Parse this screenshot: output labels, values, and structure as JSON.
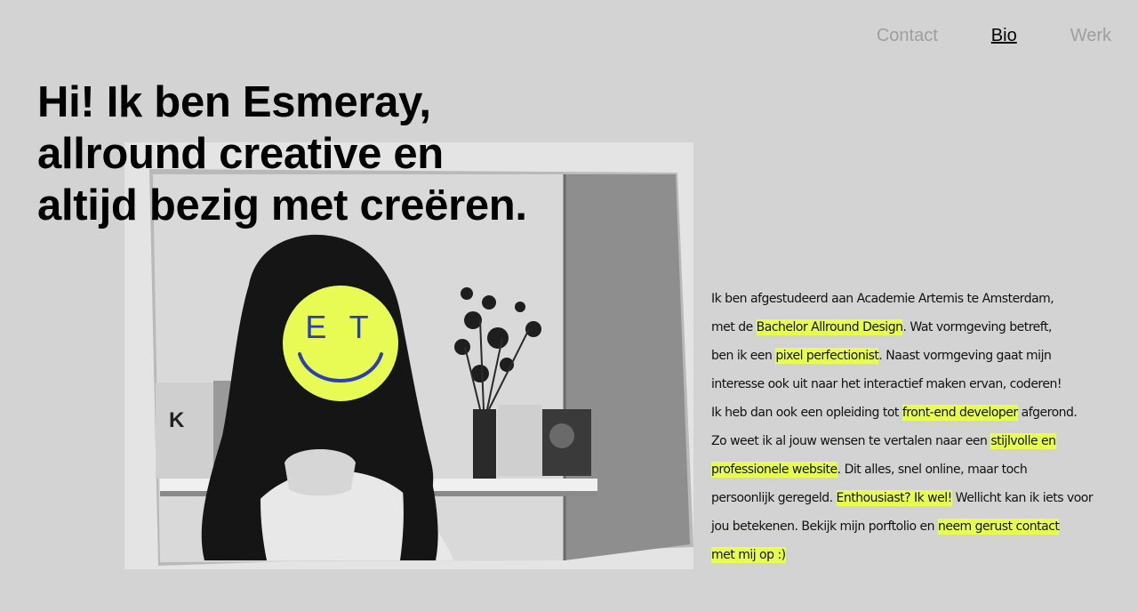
{
  "nav": {
    "items": [
      {
        "label": "Contact",
        "active": false
      },
      {
        "label": "Bio",
        "active": true
      },
      {
        "label": "Werk",
        "active": false
      }
    ]
  },
  "headline": {
    "lines": [
      "Hi! Ik ben Esmeray,",
      "allround creative en",
      "altijd bezig met creëren."
    ]
  },
  "photo": {
    "logo_letters": "E T"
  },
  "bio": {
    "segments": [
      {
        "t": "Ik ben afgestudeerd aan Academie Artemis te Amsterdam,",
        "h": false
      },
      {
        "t": "met de ",
        "h": false
      },
      {
        "t": "Bachelor Allround Design",
        "h": true
      },
      {
        "t": ". Wat vormgeving betreft,",
        "h": false
      },
      {
        "t": "ben ik een ",
        "h": false
      },
      {
        "t": "pixel perfectionist",
        "h": true
      },
      {
        "t": ". Naast vormgeving gaat mijn",
        "h": false
      },
      {
        "t": "interesse ook uit naar het interactief maken ervan, coderen!",
        "h": false
      },
      {
        "t": "Ik heb dan ook een opleiding tot ",
        "h": false
      },
      {
        "t": "front-end developer",
        "h": true
      },
      {
        "t": " afgerond.",
        "h": false
      },
      {
        "t": "Zo weet ik al jouw wensen te vertalen naar een ",
        "h": false
      },
      {
        "t": "stijlvolle en",
        "h": true
      },
      {
        "t": "professionele website",
        "h": true
      },
      {
        "t": ". Dit alles, snel online, maar toch",
        "h": false
      },
      {
        "t": "persoonlijk geregeld. ",
        "h": false
      },
      {
        "t": "Enthousiast? Ik wel!",
        "h": true
      },
      {
        "t": " Wellicht kan ik iets voor",
        "h": false
      },
      {
        "t": "jou betekenen. Bekijk mijn porftolio en ",
        "h": false
      },
      {
        "t": "neem gerust contact",
        "h": true
      },
      {
        "t": "met mij op :)",
        "h": true
      }
    ],
    "line_breaks_after": [
      0,
      3,
      6,
      7,
      10,
      12,
      14,
      17,
      19
    ]
  },
  "colors": {
    "background": "#d3d3d3",
    "highlight": "#e8ff52",
    "logo_yellow": "#e8fb55",
    "logo_blue": "#2a3fb0",
    "nav_inactive": "#9e9e9e"
  }
}
